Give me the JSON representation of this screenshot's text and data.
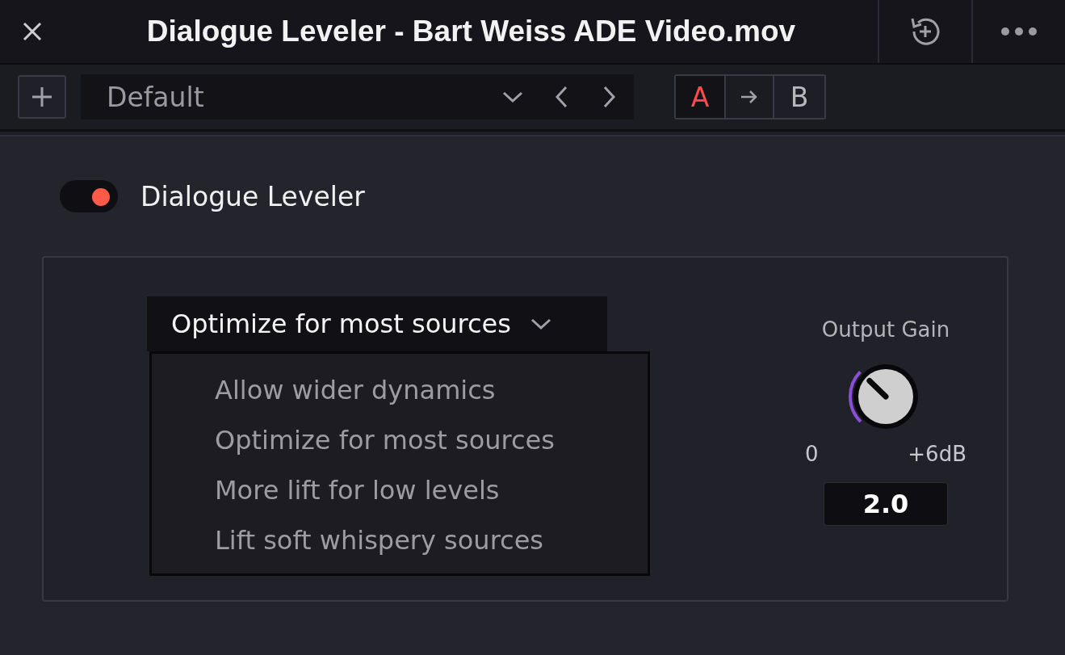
{
  "window": {
    "title": "Dialogue Leveler - Bart Weiss ADE Video.mov"
  },
  "toolbar": {
    "preset": "Default",
    "compare": [
      {
        "label": "A",
        "selected": true
      },
      {
        "label": "B",
        "selected": false
      }
    ]
  },
  "plugin": {
    "name": "Dialogue Leveler",
    "enabled": true
  },
  "mode_dropdown": {
    "value": "Optimize for most sources",
    "expanded": true,
    "options": [
      {
        "label": "Allow wider dynamics"
      },
      {
        "label": "Optimize for most sources"
      },
      {
        "label": "More lift for low levels"
      },
      {
        "label": "Lift soft whispery sources"
      }
    ]
  },
  "output_gain": {
    "label": "Output Gain",
    "min_label": "0",
    "max_label": "+6dB",
    "value": "2.0"
  }
}
